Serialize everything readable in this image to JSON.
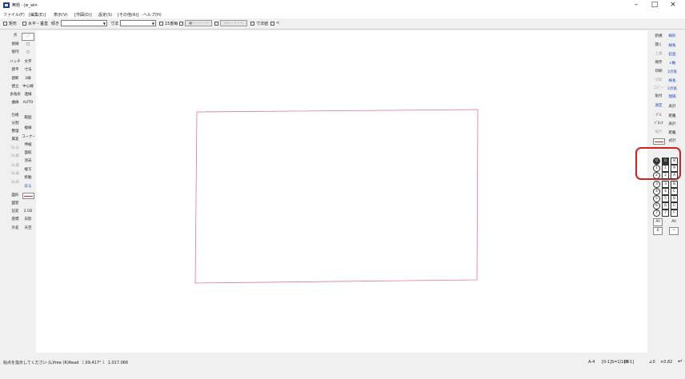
{
  "window": {
    "title": "無題 - jw_win",
    "minimize": "–",
    "maximize": "□",
    "close": "×"
  },
  "menu": [
    "ファイル(F)",
    "[編集(E)]",
    "表示(V)",
    "[作図(D)]",
    "設定(S)",
    "[その他(A)]",
    "ヘルプ(H)"
  ],
  "toolbar": {
    "rect_label": "矩形",
    "horiz_vert_label": "水平・垂直",
    "tilt_label": "傾き",
    "dim_label": "寸法",
    "angle_label": "15度毎",
    "mode_btn1": "■ー・ー・ー",
    "mode_btn2": "◇ー・ー・ー",
    "dim_value_label": "寸法値",
    "arrow_label": "<"
  },
  "left_palette": [
    [
      "点",
      "／"
    ],
    [
      "接線",
      "□"
    ],
    [
      "接円",
      "○"
    ],
    [
      "ハッチ",
      "文字"
    ],
    [
      "建平",
      "寸法"
    ],
    [
      "建断",
      "2線"
    ],
    [
      "建立",
      "中心線"
    ],
    [
      "多角形",
      "連線"
    ],
    [
      "曲線",
      "AUTO"
    ],
    [
      "包絡",
      "範囲"
    ],
    [
      "分割",
      "複線"
    ],
    [
      "整理",
      "コーナー"
    ],
    [
      "属変",
      "伸縮"
    ],
    [
      "BL化",
      "面取"
    ],
    [
      "BL解",
      "消去"
    ],
    [
      "BL属",
      "複写"
    ],
    [
      "BL編",
      "移動"
    ],
    [
      "BL終",
      "戻る"
    ],
    [
      "図形",
      ""
    ],
    [
      "図登",
      ""
    ],
    [
      "記変",
      "2.5D"
    ],
    [
      "座標",
      "日影"
    ],
    [
      "外変",
      "天空"
    ]
  ],
  "right_palette": [
    [
      "新規",
      "線形"
    ],
    [
      "開く",
      "線角"
    ],
    [
      "上書",
      "鉛直"
    ],
    [
      "保存",
      "×軸"
    ],
    [
      "印刷",
      "2点角"
    ],
    [
      "切取",
      "線長"
    ],
    [
      "コピー",
      "2点長"
    ],
    [
      "貼付",
      "間隔"
    ],
    [
      "測定",
      "表計"
    ],
    [
      "ﾂﾞﾙ",
      "距離"
    ],
    [
      "ﾌﾞﾛｯｸ",
      "表計"
    ],
    [
      "縮尺",
      "距離"
    ],
    [
      "",
      "式計"
    ]
  ],
  "layers": {
    "groups": [
      "0",
      "1",
      "2",
      "3",
      "4",
      "5",
      "6",
      "7"
    ],
    "layers": [
      "0",
      "1",
      "2",
      "3",
      "4",
      "5",
      "6",
      "7",
      "8",
      "9",
      "A",
      "B",
      "C",
      "D",
      "E",
      "F"
    ],
    "all_label": "All",
    "zero_label": "0",
    "all2_label": "All",
    "x_label": "✕"
  },
  "status": {
    "message": "始点を指示してください (L)free (R)Read 〔 09.417° 〕 1.017.066",
    "paper": "A-4",
    "scale": "[0-1]S=1/100",
    "layer": "[0-1]",
    "angle": "∠0",
    "zoom": "×0.82"
  },
  "colors": {
    "drawn_rectangle": "#e070a8",
    "highlight_ring": "#d42020"
  }
}
